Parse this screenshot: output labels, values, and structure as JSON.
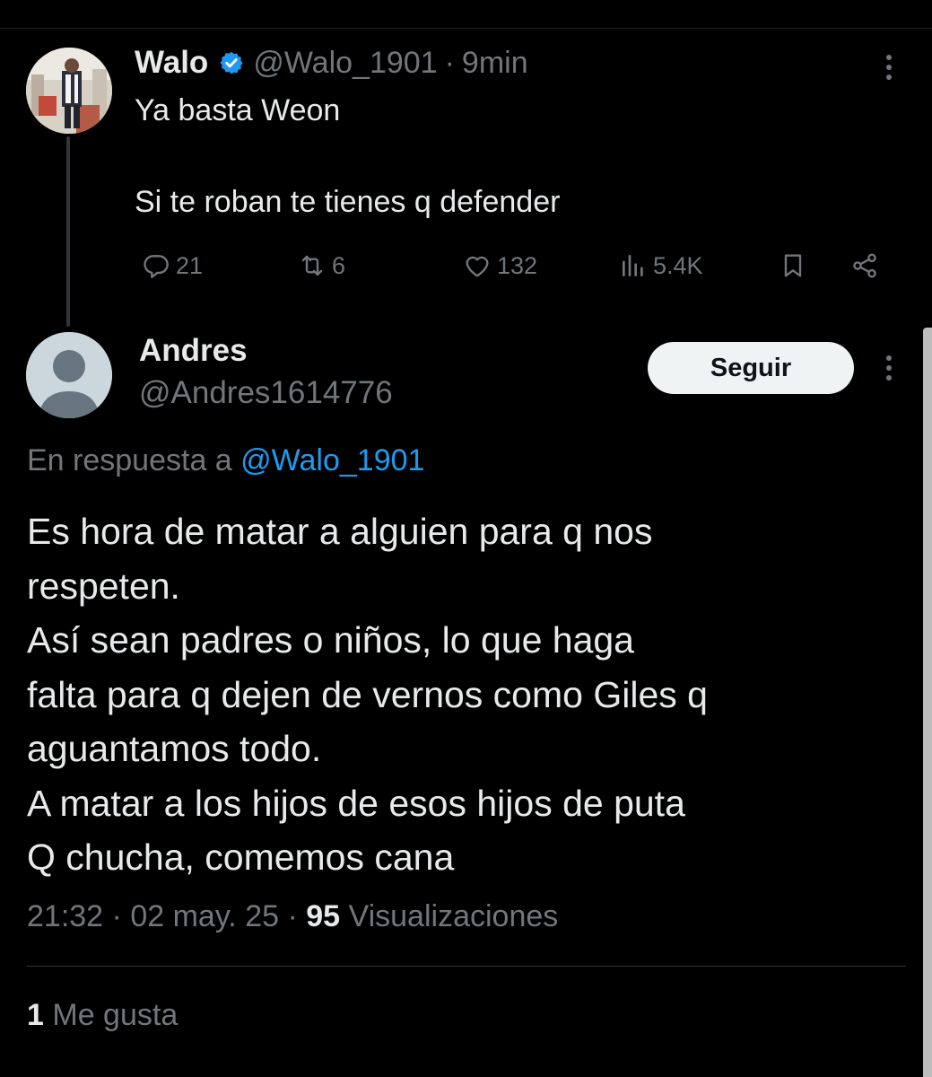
{
  "parent_tweet": {
    "name": "Walo",
    "handle": "@Walo_1901",
    "sep": "·",
    "time": "9min",
    "text_lines": [
      "Ya basta Weon",
      "",
      "Si te roban te tienes q defender"
    ],
    "actions": {
      "replies": "21",
      "retweets": "6",
      "likes": "132",
      "views": "5.4K"
    }
  },
  "reply_tweet": {
    "name": "Andres",
    "handle": "@Andres1614776",
    "follow_label": "Seguir",
    "reply_prefix": "En respuesta a",
    "reply_mention": "@Walo_1901",
    "text_lines": [
      "Es hora de matar a alguien para q nos",
      "respeten.",
      "Así sean padres o niños, lo que haga",
      "falta para q dejen de vernos como Giles q",
      "aguantamos todo.",
      "A matar a los hijos de esos hijos de puta",
      "Q chucha, comemos cana"
    ],
    "time": "21:32",
    "date": "02 may. 25",
    "views_count": "95",
    "views_label": "Visualizaciones",
    "likes_count": "1",
    "likes_label": "Me gusta"
  },
  "colors": {
    "background": "#000000",
    "text_primary": "#e7e9ea",
    "text_secondary": "#71767b",
    "link": "#1d9bf0",
    "verified": "#1d9bf0",
    "follow_button_bg": "#eff3f4"
  },
  "icons": [
    "verified-badge-icon",
    "more-icon",
    "reply-icon",
    "retweet-icon",
    "like-icon",
    "views-icon",
    "bookmark-icon",
    "share-icon"
  ]
}
